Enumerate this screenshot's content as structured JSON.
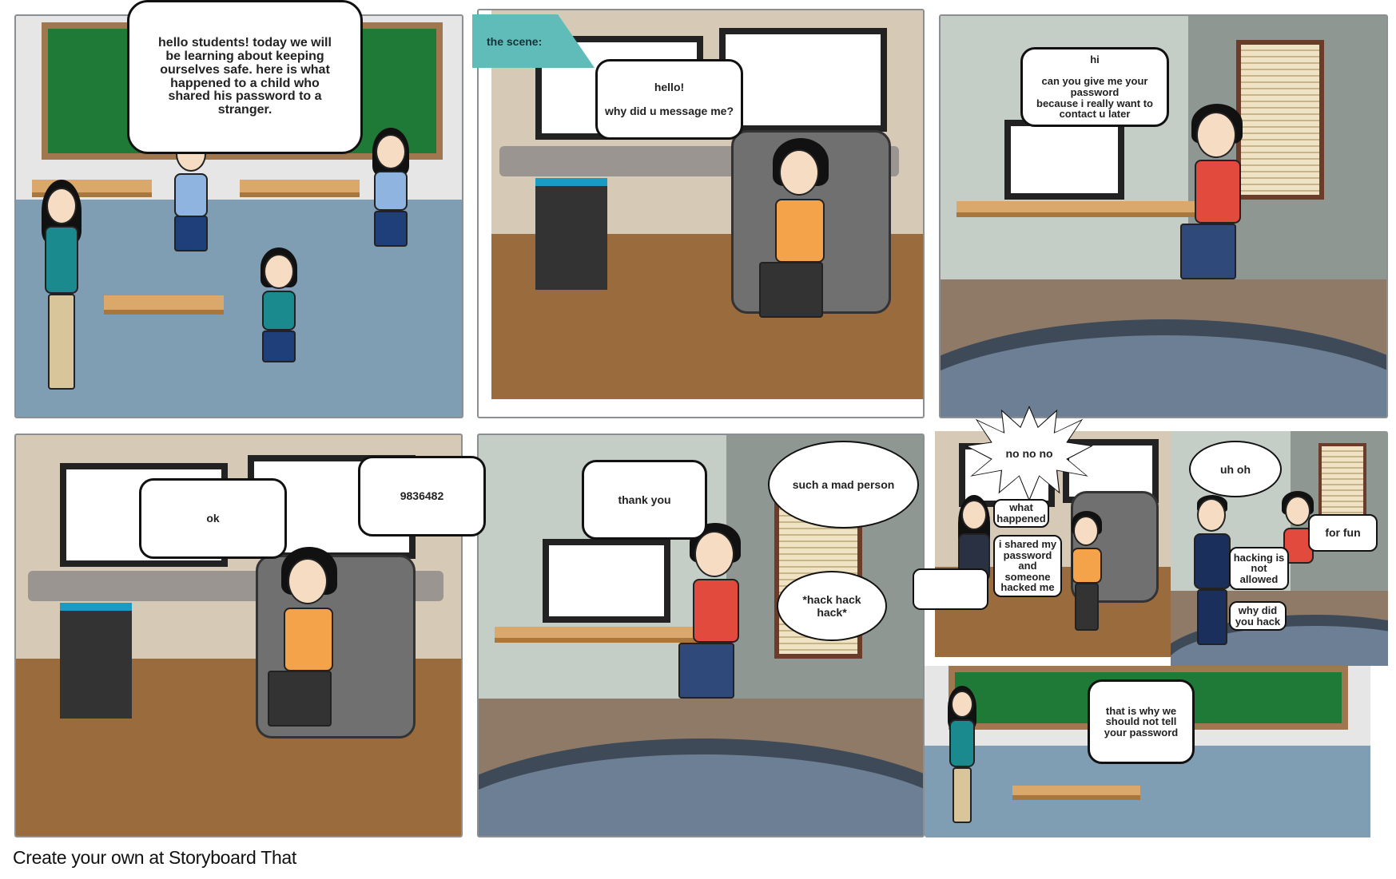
{
  "panels": [
    {
      "id": 1,
      "speech": "hello students! today we will be learning about keeping ourselves safe. here is what happened to a child who shared his password to a stranger."
    },
    {
      "id": 2,
      "caption": "the scene:",
      "speech": "hello!\n\nwhy did u  message me?"
    },
    {
      "id": 3,
      "speech": "hi\n\ncan you give me your password\nbecause i really want to contact u later"
    },
    {
      "id": 4,
      "speech_1": "ok",
      "speech_2": "9836482"
    },
    {
      "id": 5,
      "speech": "thank you",
      "thought_1": "such a mad person",
      "thought_2": "*hack hack\nhack*"
    },
    {
      "id": 6,
      "burst": "no no no",
      "speech_1": "what\nhappened",
      "speech_2": "i shared my\npassword\nand\nsomeone\nhacked me",
      "speech_3": "",
      "thought": "uh oh",
      "speech_4": "for fun",
      "speech_5": "hacking is\nnot\nallowed",
      "speech_6": "why did\nyou hack",
      "speech_7": "that is why we\nshould not tell\nyour password"
    }
  ],
  "footer": "Create your own at Storyboard That",
  "colors": {
    "caption_tab": "#5fbcb8",
    "chalkboard": "#1e7a36",
    "classroom_floor": "#7f9db3",
    "wood_floor": "#9a6b3c"
  }
}
